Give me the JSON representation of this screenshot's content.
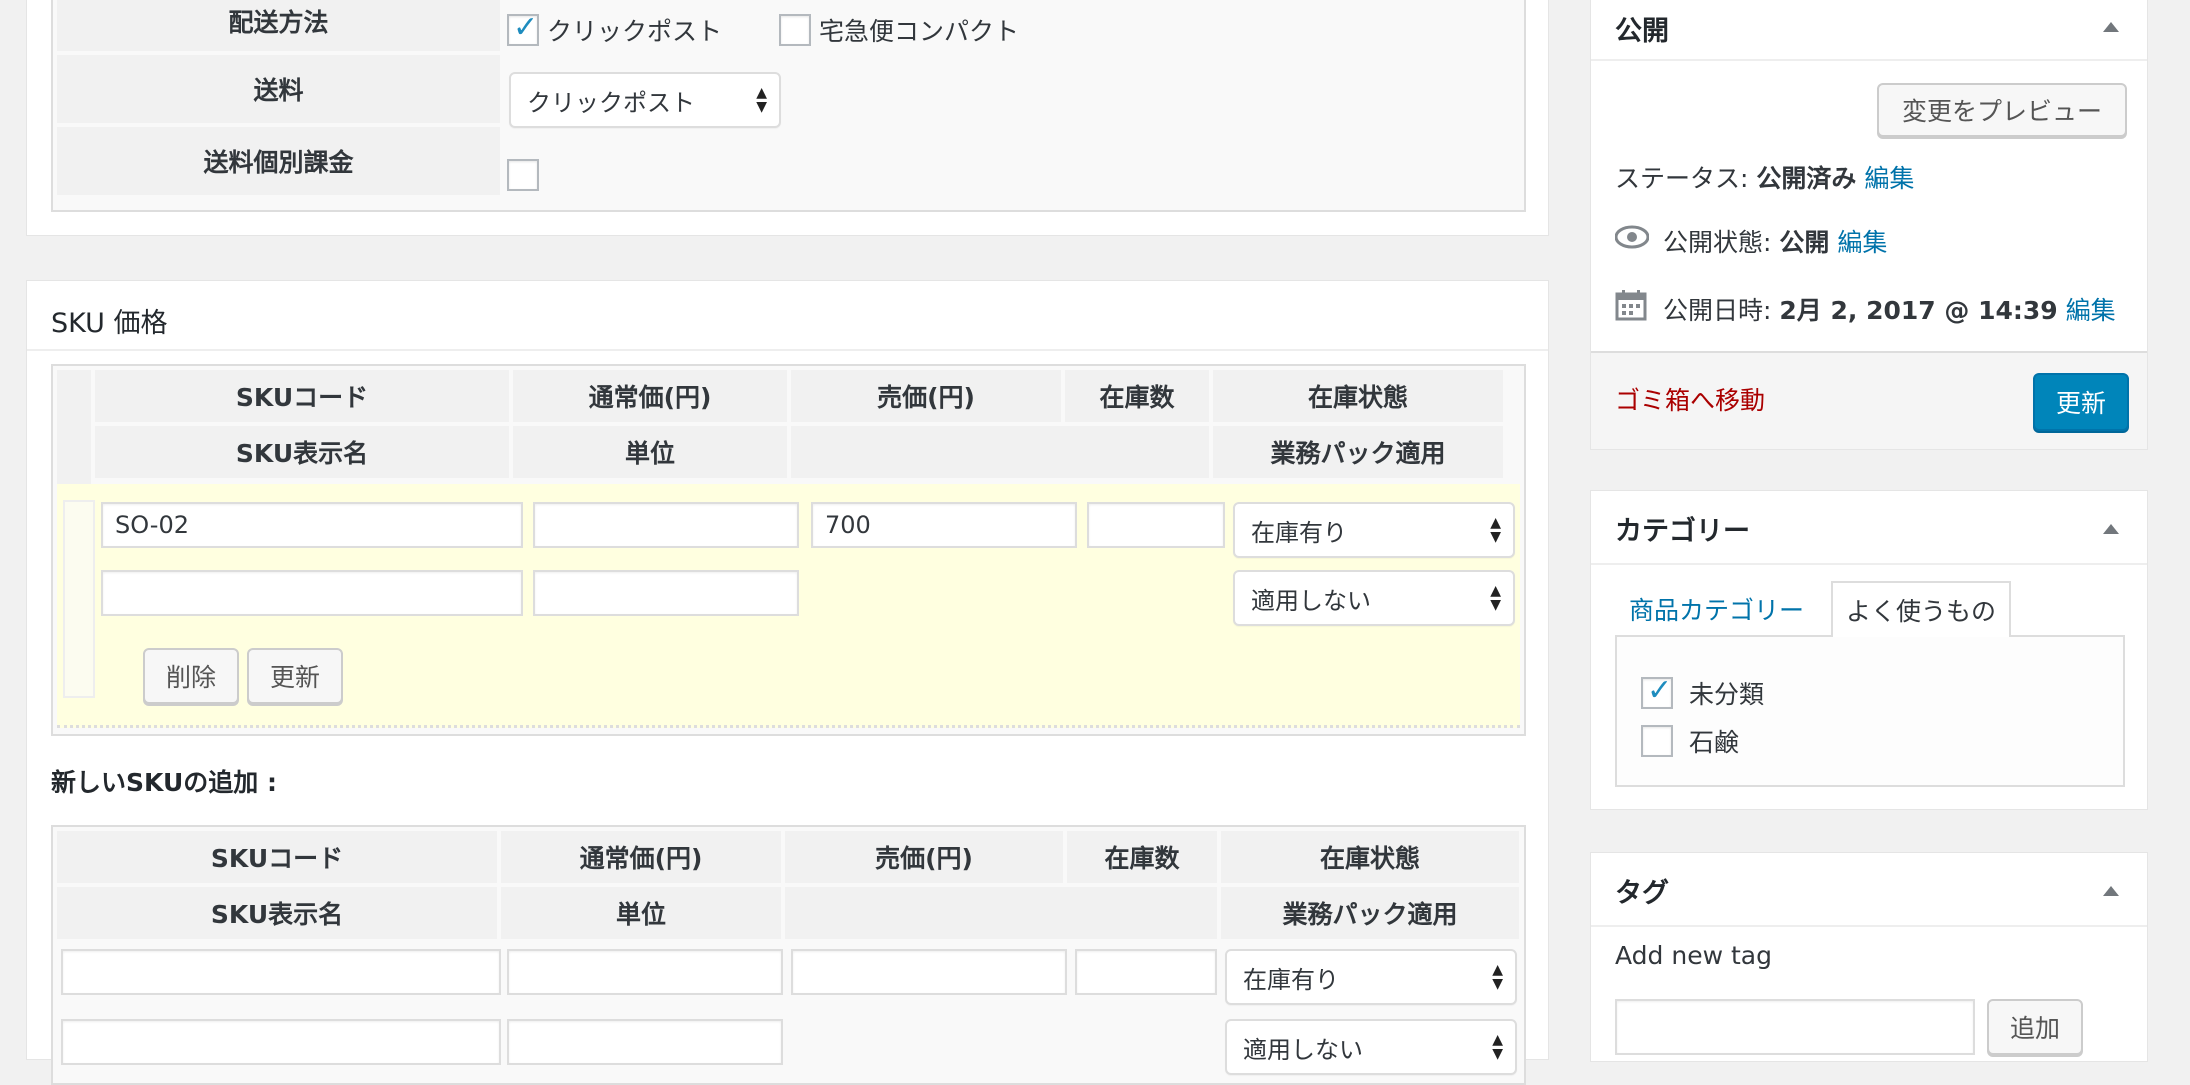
{
  "shipping": {
    "method_label": "配送方法",
    "method_options": [
      {
        "label": "クリックポスト",
        "checked": true
      },
      {
        "label": "宅急便コンパクト",
        "checked": false
      }
    ],
    "fee_label": "送料",
    "fee_select": "クリックポスト",
    "individual_label": "送料個別課金"
  },
  "sku_panel": {
    "title": "SKU 価格",
    "headers_row1": [
      "SKUコード",
      "通常価(円)",
      "売価(円)",
      "在庫数",
      "在庫状態"
    ],
    "headers_row2": [
      "SKU表示名",
      "単位",
      "業務パック適用"
    ],
    "row": {
      "code": "SO-02",
      "regular_price": "",
      "sale_price": "700",
      "stock": "",
      "stock_status": "在庫有り",
      "display_name": "",
      "unit": "",
      "pack": "適用しない"
    },
    "delete_btn": "削除",
    "update_btn": "更新",
    "new_sku_label": "新しいSKUの追加 :",
    "new_headers_row1": [
      "SKUコード",
      "通常価(円)",
      "売価(円)",
      "在庫数",
      "在庫状態"
    ],
    "new_headers_row2": [
      "SKU表示名",
      "単位",
      "業務パック適用"
    ],
    "new_stock_status": "在庫有り",
    "new_pack": "適用しない"
  },
  "publish": {
    "title": "公開",
    "preview_btn": "変更をプレビュー",
    "status_label": "ステータス:",
    "status_value": "公開済み",
    "visibility_label": "公開状態:",
    "visibility_value": "公開",
    "date_label": "公開日時:",
    "date_value": "2月 2, 2017 @ 14:39",
    "edit": "編集",
    "trash": "ゴミ箱へ移動",
    "update_btn": "更新"
  },
  "category": {
    "title": "カテゴリー",
    "tab_all": "商品カテゴリー",
    "tab_popular": "よく使うもの",
    "items": [
      {
        "label": "未分類",
        "checked": true
      },
      {
        "label": "石鹸",
        "checked": false
      }
    ]
  },
  "tags": {
    "title": "タグ",
    "add_label": "Add new tag",
    "add_btn": "追加"
  },
  "colors": {
    "link": "#0073aa",
    "primary": "#0085ba",
    "trash": "#a00",
    "row_highlight": "#ffffe0"
  }
}
